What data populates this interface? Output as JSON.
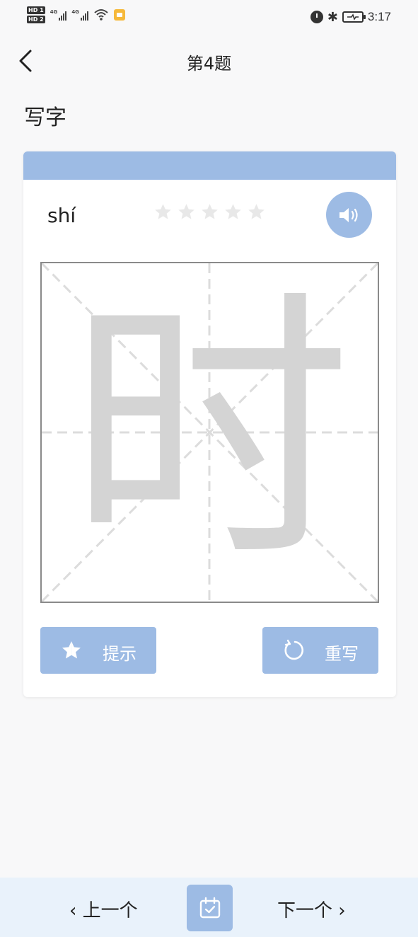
{
  "status_bar": {
    "hd_badges": [
      "HD 1",
      "HD 2"
    ],
    "signal_labels": [
      "4G",
      "4G"
    ],
    "time": "3:17",
    "icons": [
      "alarm-icon",
      "bluetooth-icon",
      "battery-charging-icon",
      "wifi-icon"
    ]
  },
  "nav": {
    "title": "第4题",
    "back_icon": "chevron-left-icon"
  },
  "section": {
    "title": "写字"
  },
  "card": {
    "pinyin": "shí",
    "character": "时",
    "rating": {
      "filled": 0,
      "max": 5
    },
    "sound_icon": "speaker-icon",
    "hint_label": "提示",
    "rewrite_label": "重写"
  },
  "bottom_bar": {
    "prev_label": "‹ 上一个",
    "next_label": "下一个 ›",
    "center_icon": "calendar-check-icon"
  },
  "colors": {
    "accent": "#9dbbe4",
    "guide_char": "#d4d4d4",
    "bottom_bar_bg": "#e9f2fb",
    "page_bg": "#f8f8f9"
  }
}
